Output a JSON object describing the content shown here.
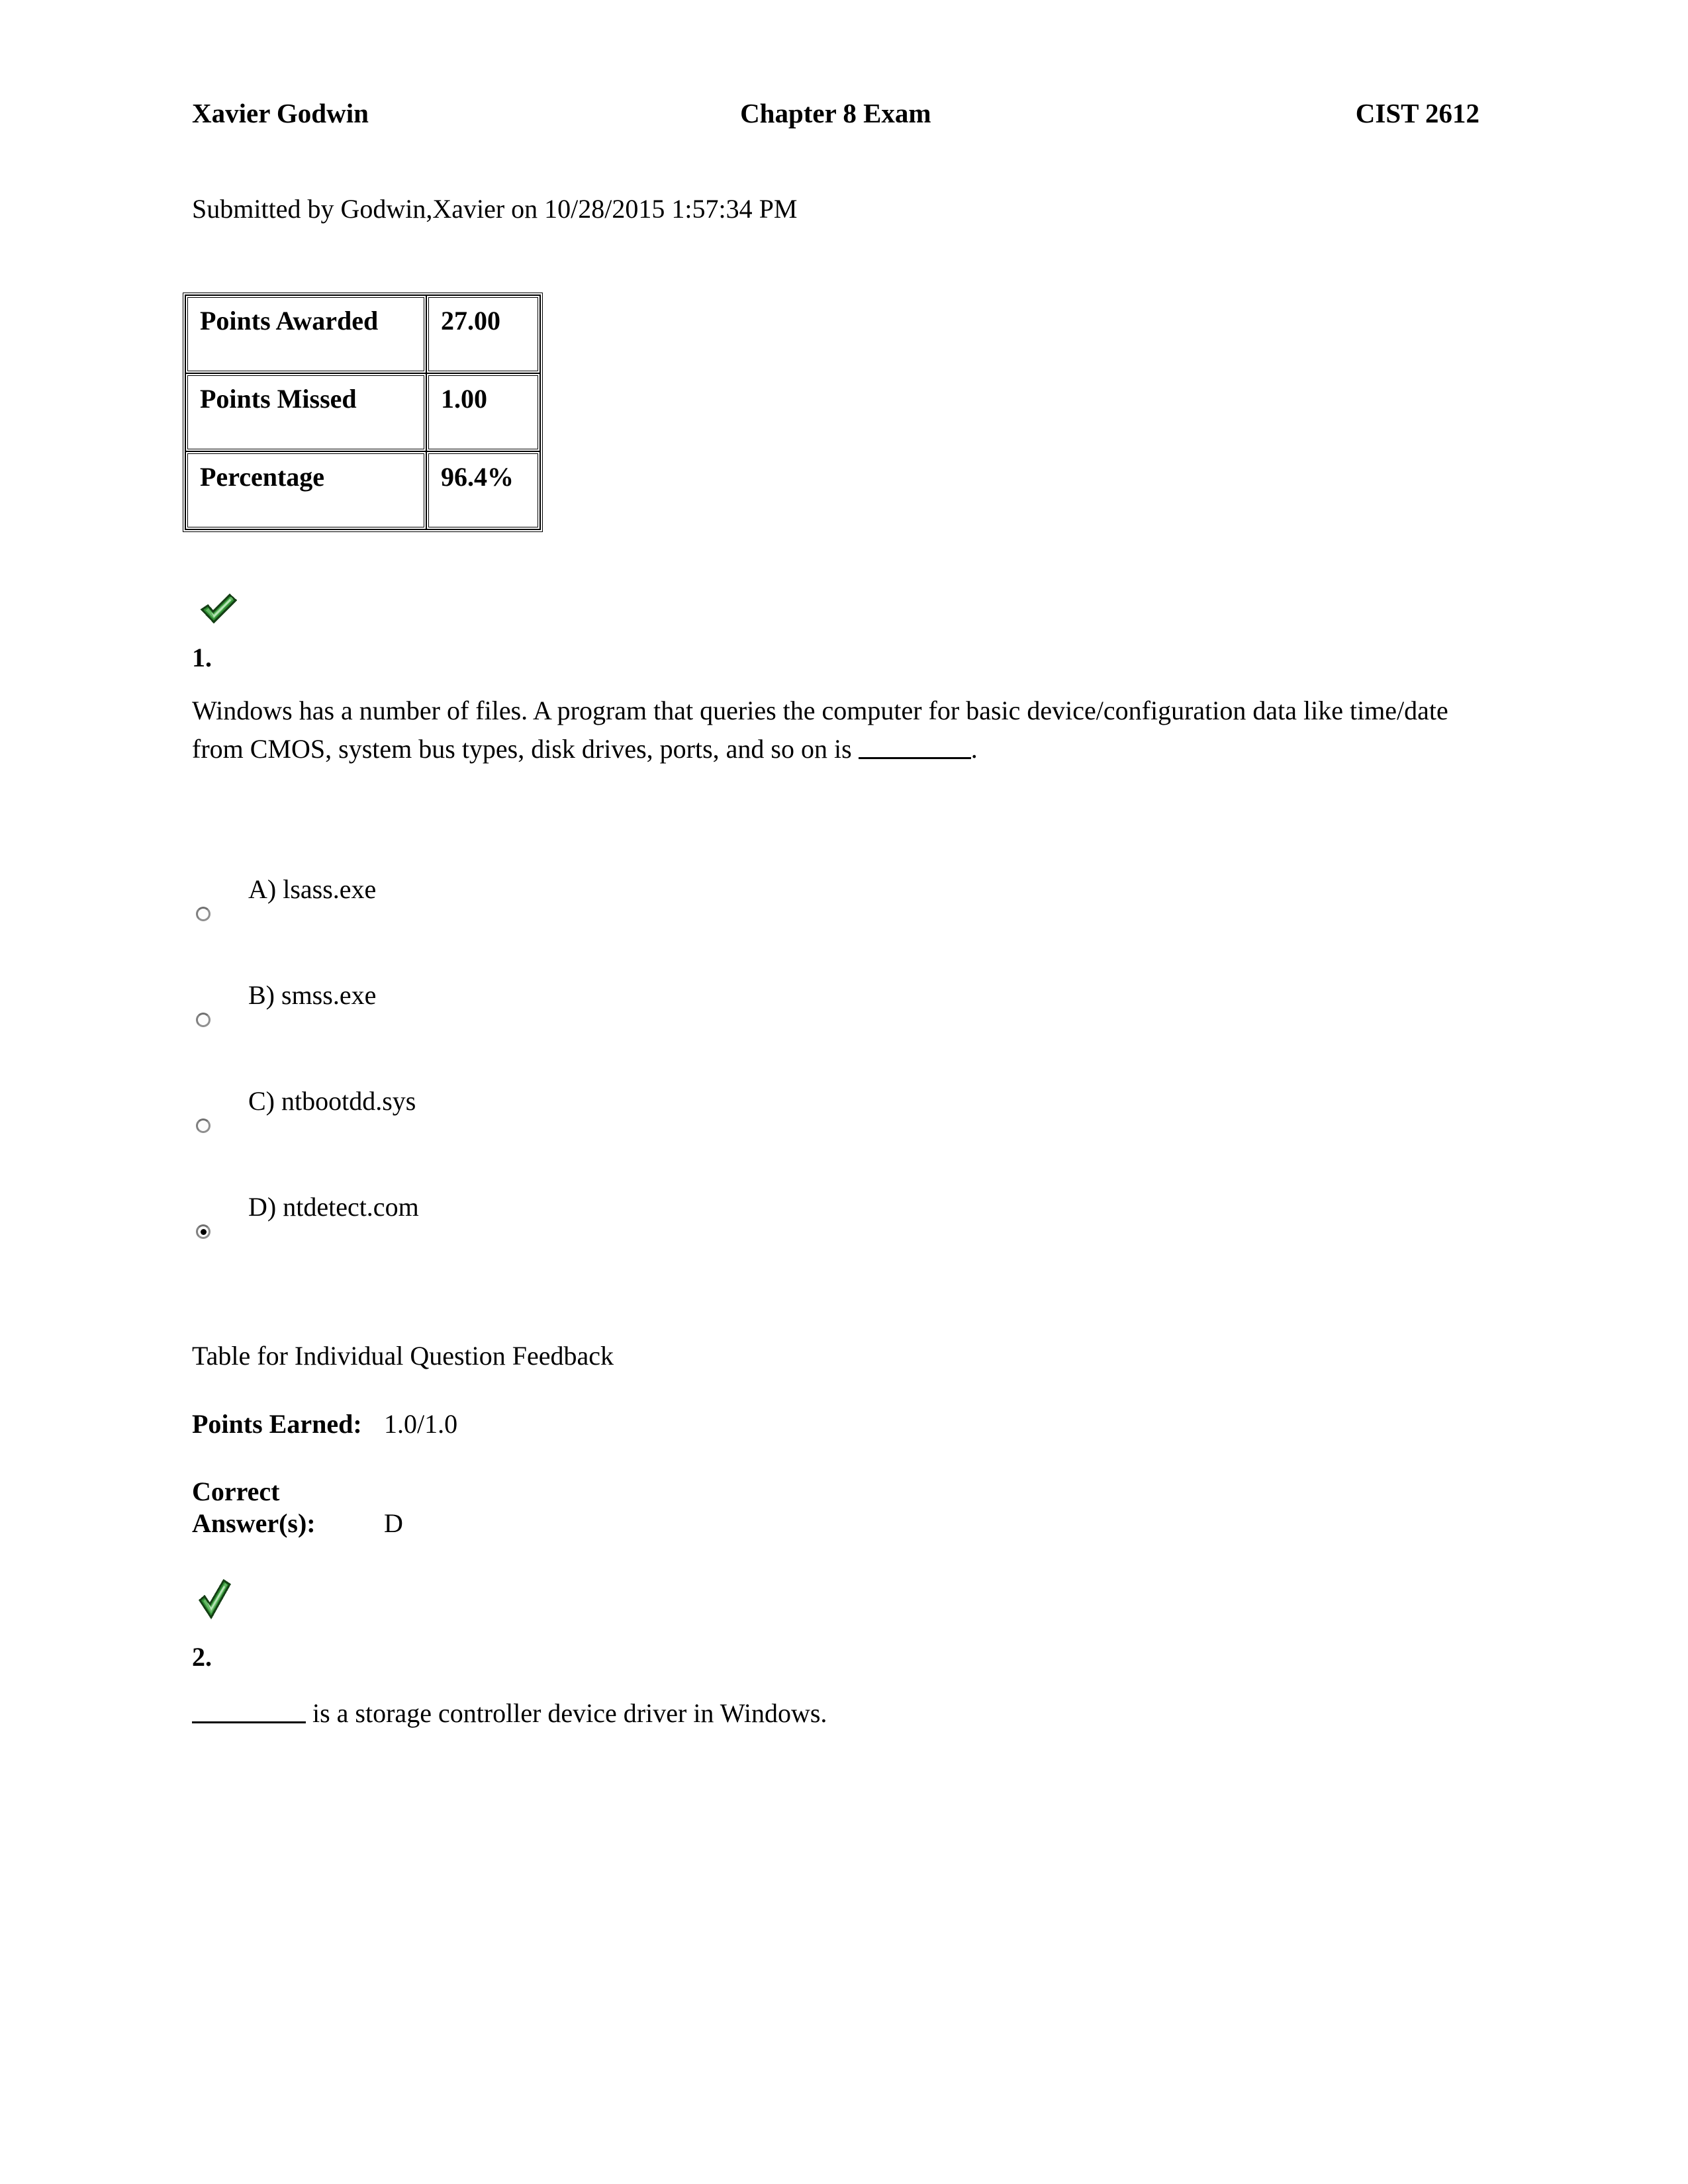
{
  "header": {
    "student_name": "Xavier Godwin",
    "exam_title": "Chapter 8 Exam",
    "course_code": "CIST 2612"
  },
  "submission": {
    "line": "Submitted by Godwin,Xavier on 10/28/2015 1:57:34 PM"
  },
  "score_table": {
    "rows": [
      {
        "label": "Points Awarded",
        "value": "27.00"
      },
      {
        "label": "Points Missed",
        "value": "1.00"
      },
      {
        "label": "Percentage",
        "value": "96.4%"
      }
    ]
  },
  "questions": [
    {
      "number": "1.",
      "status_icon": "green-check-icon",
      "text_part1": "Windows has a number of files. A program that queries the computer for basic device/configuration data like time/date from CMOS, system bus types, disk drives, ports, and so on is ",
      "text_part2": ".",
      "options": [
        {
          "label": "A) lsass.exe",
          "selected": false
        },
        {
          "label": "B) smss.exe",
          "selected": false
        },
        {
          "label": "C) ntbootdd.sys",
          "selected": false
        },
        {
          "label": "D) ntdetect.com",
          "selected": true
        }
      ],
      "feedback": {
        "title": "Table for Individual Question Feedback",
        "points_earned_label": "Points Earned:",
        "points_earned_value": "1.0/1.0",
        "correct_answer_label": "Correct Answer(s):",
        "correct_answer_value": "D"
      }
    },
    {
      "number": "2.",
      "status_icon": "green-check-icon",
      "text_part1": "",
      "text_part2": " is a storage controller device driver in Windows."
    }
  ],
  "colors": {
    "check_dark": "#1e6b1e",
    "check_mid": "#2f8f33",
    "check_light": "#7ec47e",
    "check_outline": "#143f14",
    "page_background": "#ffffff",
    "text": "#000000"
  }
}
